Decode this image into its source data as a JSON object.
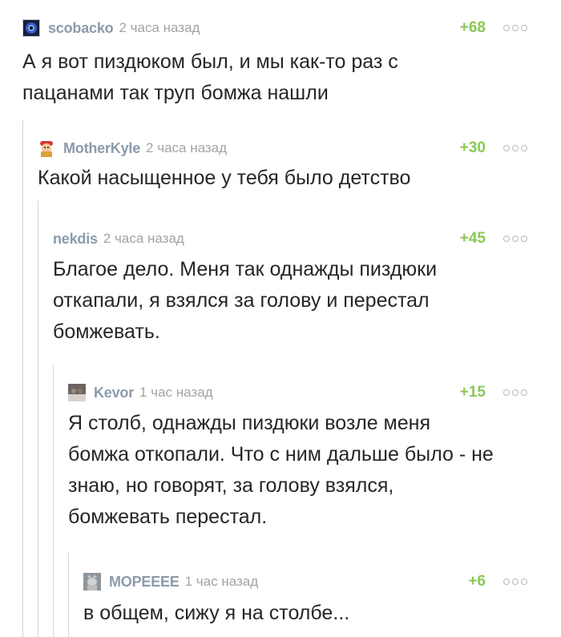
{
  "comments": [
    {
      "user": "scobacko",
      "time": "2 часа назад",
      "rating": "+68",
      "avatar_icon": "eye-avatar-icon",
      "lines": [
        "А я вот пиздюком был, и мы как-то раз с",
        "пацанами так труп бомжа нашли"
      ]
    },
    {
      "user": "MotherKyle",
      "time": "2 часа назад",
      "rating": "+30",
      "avatar_icon": "cartoon-avatar-icon",
      "lines": [
        "Какой насыщенное у тебя было детство"
      ]
    },
    {
      "user": "nekdis",
      "time": "2 часа назад",
      "rating": "+45",
      "avatar_icon": "",
      "lines": [
        "Благое дело. Меня так однажды пиздюки",
        "откапали, я взялся за голову и перестал",
        "бомжевать."
      ]
    },
    {
      "user": "Kevor",
      "time": "1 час назад",
      "rating": "+15",
      "avatar_icon": "photo-avatar-icon",
      "lines": [
        "Я столб, однажды пиздюки возле меня",
        "бомжа откопали. Что с ним дальше было - не",
        "знаю, но говорят, за голову взялся,",
        "бомжевать перестал."
      ]
    },
    {
      "user": "МОРЕЕЕЕ",
      "time": "1 час назад",
      "rating": "+6",
      "avatar_icon": "cat-avatar-icon",
      "lines": [
        "в общем, сижу я на столбе..."
      ]
    }
  ],
  "colors": {
    "username": "#8b9bab",
    "rating_positive": "#8ac858",
    "timestamp": "#a3a3a3",
    "branch_line": "#d6d6d6"
  }
}
